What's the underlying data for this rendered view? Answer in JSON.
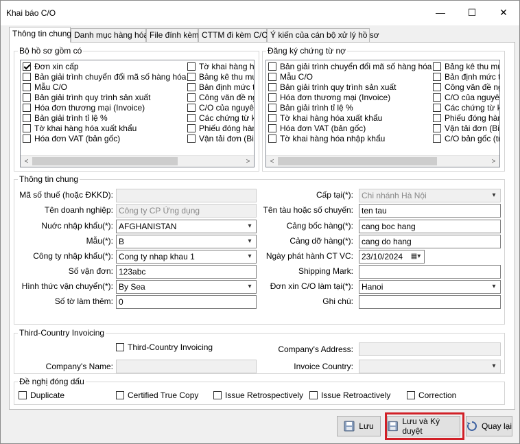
{
  "window": {
    "title": "Khai báo C/O",
    "minimize": "—",
    "maximize": "☐",
    "close": "✕"
  },
  "tabs": [
    {
      "label": "Thông tin chung"
    },
    {
      "label": "Danh mục hàng hóa"
    },
    {
      "label": "File đính kèm"
    },
    {
      "label": "CTTM đi kèm C/O"
    },
    {
      "label": "Ý kiến của cán bộ xử lý hồ sơ"
    }
  ],
  "bo_ho_so": {
    "label": "Bộ hồ sơ gồm có",
    "col1": [
      {
        "label": "Đơn xin cấp",
        "checked": true
      },
      {
        "label": "Bản giải trình chuyển đổi mã số hàng hóa",
        "checked": false
      },
      {
        "label": "Mẫu C/O",
        "checked": false
      },
      {
        "label": "Bản giải trình quy trình sản xuất",
        "checked": false
      },
      {
        "label": "Hóa đơn thương mại (Invoice)",
        "checked": false
      },
      {
        "label": "Bản giải trình tỉ lệ %",
        "checked": false
      },
      {
        "label": "Tờ khai hàng hóa xuất khẩu",
        "checked": false
      },
      {
        "label": "Hóa đơn VAT (bản gốc)",
        "checked": false
      }
    ],
    "col2": [
      {
        "label": "Tờ khai hàng hóa",
        "checked": false
      },
      {
        "label": "Bảng kê thu mua",
        "checked": false
      },
      {
        "label": "Bản định mức tiêu",
        "checked": false
      },
      {
        "label": "Công văn đề nghị",
        "checked": false
      },
      {
        "label": "C/O của nguyên l",
        "checked": false
      },
      {
        "label": "Các chứng từ khá",
        "checked": false
      },
      {
        "label": "Phiếu đóng hàng",
        "checked": false
      },
      {
        "label": "Vận tải đơn (Bill of",
        "checked": false
      }
    ]
  },
  "dang_ky": {
    "label": "Đăng ký chứng từ nợ",
    "col1": [
      {
        "label": "Bản giải trình chuyển đổi mã số hàng hóa",
        "checked": false
      },
      {
        "label": "Mẫu C/O",
        "checked": false
      },
      {
        "label": "Bản giải trình quy trình sản xuất",
        "checked": false
      },
      {
        "label": "Hóa đơn thương mại (Invoice)",
        "checked": false
      },
      {
        "label": "Bản giải trình tỉ lệ %",
        "checked": false
      },
      {
        "label": "Tờ khai hàng hóa xuất khẩu",
        "checked": false
      },
      {
        "label": "Hóa đơn VAT (bản gốc)",
        "checked": false
      },
      {
        "label": "Tờ khai hàng hóa nhập khẩu",
        "checked": false
      }
    ],
    "col2": [
      {
        "label": "Bảng kê thu mua",
        "checked": false
      },
      {
        "label": "Bản định mức tiêu",
        "checked": false
      },
      {
        "label": "Công văn đề nghị",
        "checked": false
      },
      {
        "label": "C/O của nguyên l",
        "checked": false
      },
      {
        "label": "Các chứng từ khá",
        "checked": false
      },
      {
        "label": "Phiếu đóng hàng",
        "checked": false
      },
      {
        "label": "Vận tải đơn (Bill of",
        "checked": false
      },
      {
        "label": "C/O bản gốc (trướ",
        "checked": false
      }
    ]
  },
  "thong_tin_chung": {
    "label": "Thông tin chung",
    "ma_so_thue": {
      "label": "Mã số thuế (hoặc ĐKKD):",
      "value": ""
    },
    "ten_dn": {
      "label": "Tên doanh nghiệp:",
      "value": "Công ty CP Ứng dụng"
    },
    "nuoc_nk": {
      "label": "Nuớc nhập khẩu(*):",
      "value": "AFGHANISTAN"
    },
    "mau": {
      "label": "Mẫu(*):",
      "value": "B"
    },
    "cong_ty_nk": {
      "label": "Công ty nhập khẩu(*):",
      "value": "Cong ty nhap khau 1"
    },
    "so_van_don": {
      "label": "Số vận đơn:",
      "value": "123abc"
    },
    "hinh_thuc": {
      "label": "Hình thức vận chuyển(*):",
      "value": "By Sea"
    },
    "so_to": {
      "label": "Số tờ làm thêm:",
      "value": "0"
    },
    "cap_tai": {
      "label": "Cấp tại(*):",
      "value": "Chi nhánh Hà Nội"
    },
    "ten_tau": {
      "label": "Tên tàu hoặc số chuyến:",
      "value": "ten tau"
    },
    "cang_boc": {
      "label": "Cảng bốc hàng(*):",
      "value": "cang boc hang"
    },
    "cang_do": {
      "label": "Cảng dỡ hàng(*):",
      "value": "cang do hang"
    },
    "ngay_ph": {
      "label": "Ngày phát hành CT VC:",
      "value": "23/10/2024"
    },
    "shipping": {
      "label": "Shipping Mark:",
      "value": ""
    },
    "don_xin": {
      "label": "Đơn xin C/O làm tại(*):",
      "value": "Hanoi"
    },
    "ghi_chu": {
      "label": "Ghi chú:",
      "value": ""
    }
  },
  "third_country": {
    "label": "Third-Country Invoicing",
    "checkbox": "Third-Country Invoicing",
    "company_name": "Company's Name:",
    "company_address": "Company's Address:",
    "invoice_country": "Invoice Country:"
  },
  "de_nghi": {
    "label": "Đề nghị đóng dấu",
    "items": [
      {
        "label": "Duplicate"
      },
      {
        "label": "Certified True Copy"
      },
      {
        "label": "Issue Retrospectively"
      },
      {
        "label": "Issue Retroactively"
      },
      {
        "label": "Correction"
      }
    ]
  },
  "buttons": {
    "luu": "Lưu",
    "luu_ky": "Lưu và Ký duyệt",
    "quay_lai": "Quay lại"
  },
  "colors": {
    "highlight": "#d12027",
    "window_bg": "#f0f0f0"
  }
}
